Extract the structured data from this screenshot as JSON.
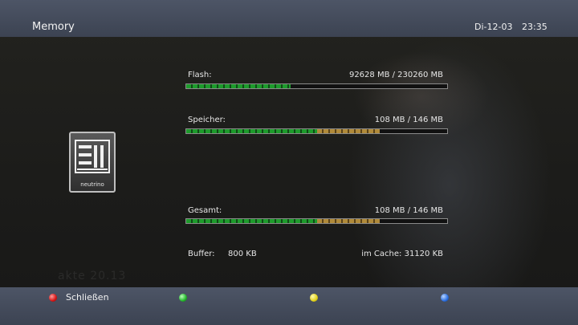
{
  "header": {
    "title": "Memory",
    "date": "Di-12-03",
    "time": "23:35"
  },
  "logo": {
    "brand": "neutrino"
  },
  "memory": [
    {
      "label": "Flash:",
      "value": "92628 MB / 230260 MB",
      "fill_fraction": 0.4,
      "warm_from": null
    },
    {
      "label": "Speicher:",
      "value": "108 MB / 146 MB",
      "fill_fraction": 0.74,
      "warm_from": 0.5
    },
    {
      "label": "Gesamt:",
      "value": "108 MB / 146 MB",
      "fill_fraction": 0.74,
      "warm_from": 0.5
    }
  ],
  "buffer": {
    "label": "Buffer:",
    "value": "800 KB",
    "cache": "im Cache: 31120 KB"
  },
  "watermark": "akte 20.13",
  "footer": {
    "red_label": "Schließen",
    "colors": {
      "red": "#d41414",
      "green": "#22b52a",
      "yellow": "#e2d21a",
      "blue": "#2a6ee0"
    }
  },
  "colors": {
    "bar_green": "#1e9b2c",
    "bar_amber": "#b08a3a",
    "bar_header": "#4d5566"
  }
}
